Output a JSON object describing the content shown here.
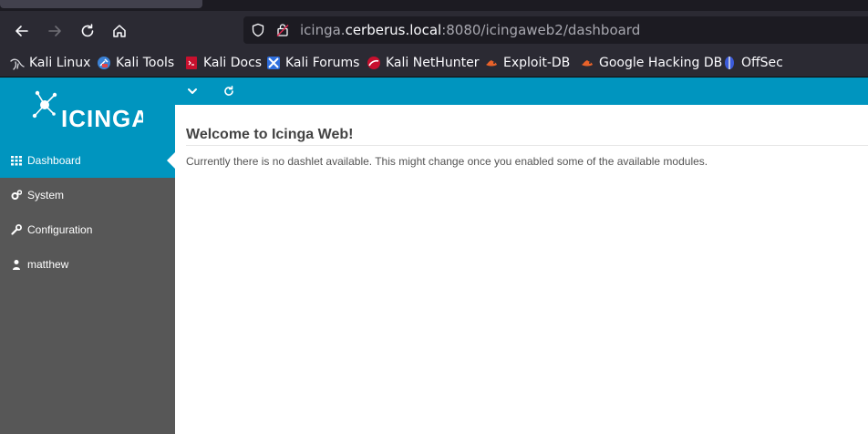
{
  "browser": {
    "url_prefix": "icinga.",
    "url_host": "cerberus.local",
    "url_rest": ":8080/icingaweb2/dashboard"
  },
  "bookmarks": [
    {
      "label": "Kali Linux",
      "icon": "kali-dragon-icon"
    },
    {
      "label": "Kali Tools",
      "icon": "kali-tools-icon"
    },
    {
      "label": "Kali Docs",
      "icon": "kali-docs-icon"
    },
    {
      "label": "Kali Forums",
      "icon": "kali-forums-icon"
    },
    {
      "label": "Kali NetHunter",
      "icon": "nethunter-icon"
    },
    {
      "label": "Exploit-DB",
      "icon": "exploit-db-icon"
    },
    {
      "label": "Google Hacking DB",
      "icon": "ghdb-icon"
    },
    {
      "label": "OffSec",
      "icon": "offsec-icon"
    }
  ],
  "app": {
    "logo_text": "icinga",
    "nav": [
      {
        "label": "Dashboard",
        "icon": "grid-icon",
        "active": true
      },
      {
        "label": "System",
        "icon": "cogs-icon",
        "active": false
      },
      {
        "label": "Configuration",
        "icon": "wrench-icon",
        "active": false
      },
      {
        "label": "matthew",
        "icon": "user-icon",
        "active": false
      }
    ],
    "content": {
      "title": "Welcome to Icinga Web!",
      "message": "Currently there is no dashlet available. This might change once you enabled some of the available modules."
    }
  },
  "colors": {
    "icinga_blue": "#0095bf",
    "sidebar_gray": "#575757",
    "browser_dark": "#2b2a33"
  }
}
